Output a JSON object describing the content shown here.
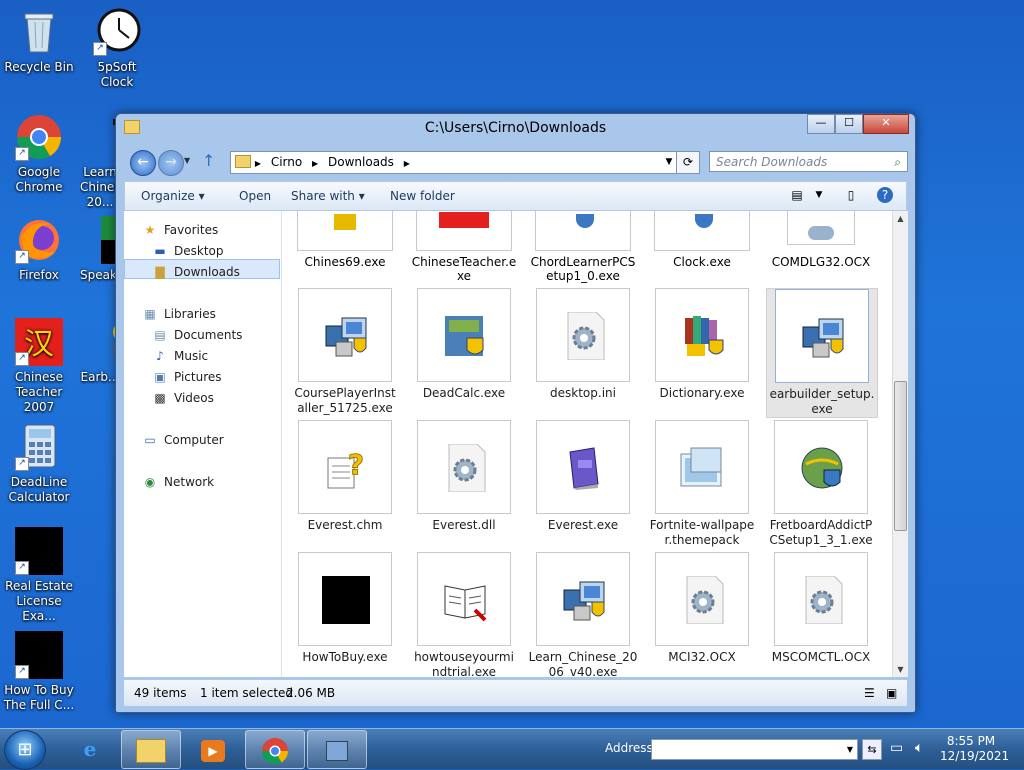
{
  "desktop": {
    "icons": [
      {
        "label": "Recycle Bin"
      },
      {
        "label": "5pSoft Clock"
      },
      {
        "label": "Google Chrome"
      },
      {
        "label": "Learn Chinese 20..."
      },
      {
        "label": "Firefox"
      },
      {
        "label": "Speak..."
      },
      {
        "label": "Chinese Teacher 2007"
      },
      {
        "label": "Earb..."
      },
      {
        "label": "DeadLine Calculator"
      },
      {
        "label": "Real Estate License Exa..."
      },
      {
        "label": "How To Buy The Full C..."
      }
    ]
  },
  "window": {
    "title": "C:\\Users\\Cirno\\Downloads",
    "buttons": {
      "minimize": "—",
      "maximize": "☐",
      "close": "✕"
    },
    "breadcrumb": [
      "Cirno",
      "Downloads"
    ],
    "search_placeholder": "Search Downloads",
    "toolbar": {
      "organize": "Organize",
      "open": "Open",
      "share_with": "Share with",
      "new_folder": "New folder"
    },
    "nav": {
      "favorites": "Favorites",
      "desktop": "Desktop",
      "downloads": "Downloads",
      "libraries": "Libraries",
      "documents": "Documents",
      "music": "Music",
      "pictures": "Pictures",
      "videos": "Videos",
      "computer": "Computer",
      "network": "Network"
    },
    "files_top_row": [
      "Chines69.exe",
      "ChineseTeacher.e xe",
      "ChordLearnerPCS etup1_0.exe",
      "Clock.exe",
      "COMDLG32.OCX"
    ],
    "files": [
      {
        "name": "CoursePlayerInst aller_51725.exe",
        "icon": "installer-icon"
      },
      {
        "name": "DeadCalc.exe",
        "icon": "calculator-installer-icon"
      },
      {
        "name": "desktop.ini",
        "icon": "gear-file-icon"
      },
      {
        "name": "Dictionary.exe",
        "icon": "books-installer-icon"
      },
      {
        "name": "earbuilder_setup. exe",
        "icon": "installer-icon",
        "selected": true
      },
      {
        "name": "Everest.chm",
        "icon": "help-file-icon"
      },
      {
        "name": "Everest.dll",
        "icon": "gear-file-icon"
      },
      {
        "name": "Everest.exe",
        "icon": "purple-book-icon"
      },
      {
        "name": "Fortnite-wallpape r.themepack",
        "icon": "themepack-icon"
      },
      {
        "name": "FretboardAddictP CSetup1_3_1.exe",
        "icon": "globe-installer-icon"
      },
      {
        "name": "HowToBuy.exe",
        "icon": "black-square-icon"
      },
      {
        "name": "howtouseyourmi ndtrial.exe",
        "icon": "book-icon"
      },
      {
        "name": "Learn_Chinese_20 06_v40.exe",
        "icon": "installer-icon"
      },
      {
        "name": "MCI32.OCX",
        "icon": "gear-file-icon"
      },
      {
        "name": "MSCOMCTL.OCX",
        "icon": "gear-file-icon"
      }
    ],
    "status": {
      "count": "49 items",
      "selection": "1 item selected",
      "size": "2.06 MB"
    }
  },
  "taskbar": {
    "address_label": "Address",
    "time": "8:55 PM",
    "date": "12/19/2021"
  }
}
